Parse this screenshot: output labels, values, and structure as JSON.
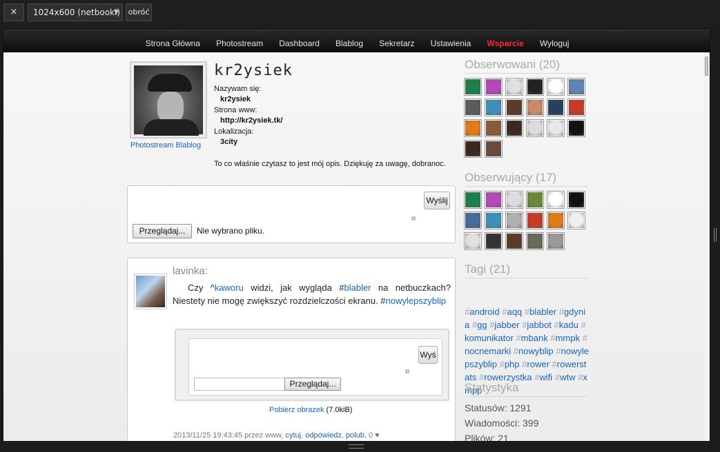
{
  "toolbar": {
    "close_icon": "×",
    "resolution": "1024x600 (netbooki)",
    "rotate": "obróć"
  },
  "nav": {
    "items": [
      {
        "label": "Strona Główna"
      },
      {
        "label": "Photostream"
      },
      {
        "label": "Dashboard"
      },
      {
        "label": "Blablog"
      },
      {
        "label": "Sekretarz"
      },
      {
        "label": "Ustawienia"
      },
      {
        "label": "Wsparcie",
        "color": "#ff2a2a"
      },
      {
        "label": "Wyloguj"
      }
    ]
  },
  "profile": {
    "username": "kr2ysiek",
    "links": "Photostream Blablog",
    "name_label": "Nazywam się:",
    "name_value": "kr2ysiek",
    "www_label": "Strona www:",
    "www_value": "http://kr2ysiek.tk/",
    "location_label": "Lokalizacja:",
    "location_value": "3city",
    "description": "To co właśnie czytasz to jest mój opis. Dziękuję za uwagę, dobranoc."
  },
  "post_form": {
    "send_label": "Wyślij",
    "browse_label": "Przeglądaj...",
    "no_file": "Nie wybrano pliku."
  },
  "status": {
    "author": "lavinka:",
    "text_1": "Czy ^",
    "mention": "kaworu",
    "text_2": " widzi, jak wygląda #",
    "tag_1": "blabler",
    "text_3": " na netbuczkach? Niestety nie mogę zwiększyć rozdzielczości ekranu. #",
    "tag_2": "nowylepszyblip",
    "reply_send_label": "Wyś",
    "reply_browse_label": "Przeglądaj...",
    "download_link": "Pobierz obrazek",
    "download_size": " (7.0kiB)",
    "meta_time": "2013/11/25 19:43:45 przez www, ",
    "meta_actions": [
      "cytuj",
      "odpowiedz",
      "polub"
    ],
    "meta_likes": ", 0 ♥"
  },
  "sidebar": {
    "following_title": "Obserwowani (20)",
    "followers_title": "Obserwujący (17)",
    "tags_title": "Tagi (21)",
    "stats_title": "Statystyka",
    "following_colors": [
      "#1f7f4a",
      "#b24ab8",
      "#e0e0e0",
      "#222222",
      "#ffffff",
      "#5e86b0",
      "#5c5c5c",
      "#3d90b8",
      "#5b3a2a",
      "#c88a6a",
      "#27405c",
      "#c73a2a",
      "#e07b1a",
      "#8a5a3a",
      "#3b2a22",
      "#dcdcdc",
      "#e8e8e8",
      "#111111",
      "#3a2820",
      "#6a4a3a"
    ],
    "followers_colors": [
      "#1f7f4a",
      "#b24ab8",
      "#dcdcdc",
      "#6a8a3a",
      "#ffffff",
      "#111111",
      "#4a6a9a",
      "#3d90b8",
      "#b0b0b0",
      "#c73a2a",
      "#e07b1a",
      "#f0f0f0",
      "#e0e0e0",
      "#333333",
      "#5b3a2a",
      "#6a6a5a",
      "#9a9a9a"
    ],
    "tags": [
      "android",
      "aqq",
      "blabler",
      "gdynia",
      "gg",
      "jabber",
      "jabbot",
      "kadu",
      "komunikator",
      "mbank",
      "mmpk",
      "nocnemarki",
      "nowyblip",
      "nowylepszyblip",
      "php",
      "rower",
      "rowerstats",
      "rowerzystka",
      "wifi",
      "wtw",
      "xmpp"
    ],
    "stats": [
      {
        "label": "Statusów: 1291"
      },
      {
        "label": "Wiadomości: 399"
      },
      {
        "label": "Plików: 21"
      }
    ]
  }
}
